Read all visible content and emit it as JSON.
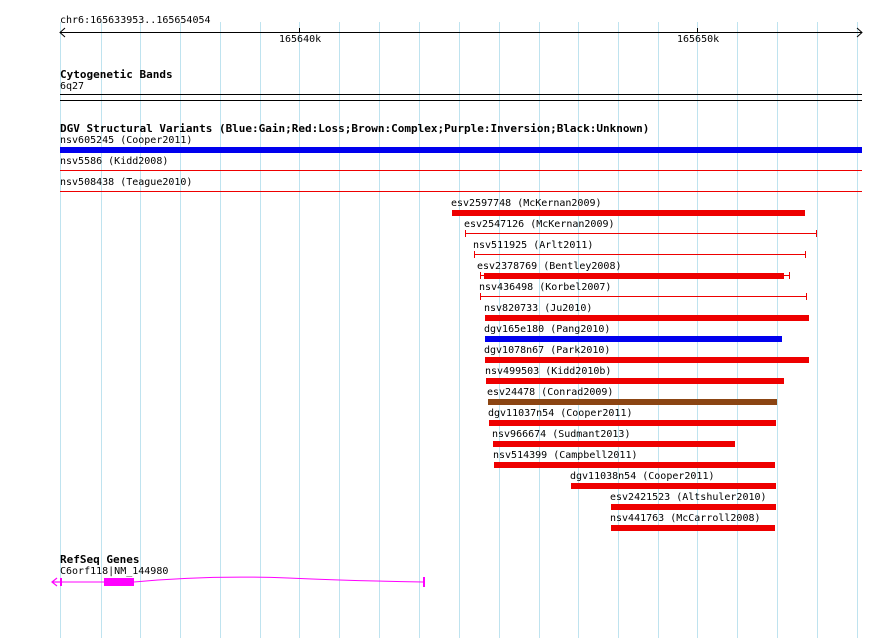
{
  "ruler": {
    "region": "chr6:165633953..165654054",
    "ticks": [
      "165640k",
      "165650k"
    ]
  },
  "cytoband": {
    "title": "Cytogenetic Bands",
    "band": "6q27"
  },
  "dgv": {
    "title": "DGV Structural Variants (Blue:Gain;Red:Loss;Brown:Complex;Purple:Inversion;Black:Unknown)",
    "colors": {
      "gain": "#0000ee",
      "loss": "#ee0000",
      "complex": "#8b4513"
    },
    "variants": [
      {
        "label": "nsv605245 (Cooper2011)",
        "type": "gain",
        "style": "thick"
      },
      {
        "label": "nsv5586 (Kidd2008)",
        "type": "loss",
        "style": "thin"
      },
      {
        "label": "nsv508438 (Teague2010)",
        "type": "loss",
        "style": "thin"
      },
      {
        "label": "esv2597748 (McKernan2009)",
        "type": "loss",
        "style": "thick"
      },
      {
        "label": "esv2547126 (McKernan2009)",
        "type": "loss",
        "style": "capped"
      },
      {
        "label": "nsv511925 (Arlt2011)",
        "type": "loss",
        "style": "capped"
      },
      {
        "label": "esv2378769 (Bentley2008)",
        "type": "loss",
        "style": "thick-capped"
      },
      {
        "label": "nsv436498 (Korbel2007)",
        "type": "loss",
        "style": "capped"
      },
      {
        "label": "nsv820733 (Ju2010)",
        "type": "loss",
        "style": "thick"
      },
      {
        "label": "dgv165e180 (Pang2010)",
        "type": "gain",
        "style": "thick"
      },
      {
        "label": "dgv1078n67 (Park2010)",
        "type": "loss",
        "style": "thick"
      },
      {
        "label": "nsv499503 (Kidd2010b)",
        "type": "loss",
        "style": "thick"
      },
      {
        "label": "esv24478 (Conrad2009)",
        "type": "complex",
        "style": "thick"
      },
      {
        "label": "dgv11037n54 (Cooper2011)",
        "type": "loss",
        "style": "thick"
      },
      {
        "label": "nsv966674 (Sudmant2013)",
        "type": "loss",
        "style": "thick"
      },
      {
        "label": "nsv514399 (Campbell2011)",
        "type": "loss",
        "style": "thick"
      },
      {
        "label": "dgv11038n54 (Cooper2011)",
        "type": "loss",
        "style": "thick"
      },
      {
        "label": "esv2421523 (Altshuler2010)",
        "type": "loss",
        "style": "thick"
      },
      {
        "label": "nsv441763 (McCarroll2008)",
        "type": "loss",
        "style": "thick"
      }
    ]
  },
  "refseq": {
    "title": "RefSeq Genes",
    "gene_label": "C6orf118|NM_144980",
    "color": "#ff00ff"
  },
  "icons": [
    "left-arrow-icon",
    "right-arrow-icon",
    "strand-arrow-icon"
  ]
}
